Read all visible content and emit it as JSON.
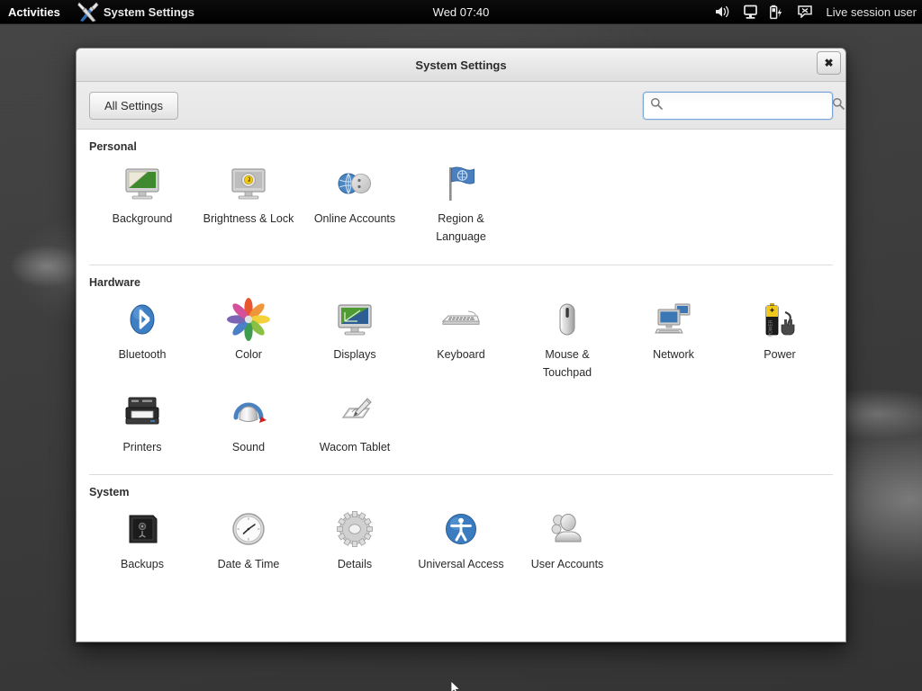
{
  "topbar": {
    "activities_label": "Activities",
    "app_icon": "tools-icon",
    "app_label": "System Settings",
    "clock": "Wed 07:40",
    "indicators": [
      {
        "name": "volume-icon",
        "label": "volume"
      },
      {
        "name": "display-icon",
        "label": "display"
      },
      {
        "name": "battery-charging-icon",
        "label": "battery"
      },
      {
        "name": "messages-icon",
        "label": "messages"
      }
    ],
    "user_label": "Live session user"
  },
  "window": {
    "title": "System Settings",
    "close_label": "✖"
  },
  "toolbar": {
    "all_settings_label": "All Settings",
    "search_placeholder": "",
    "search_value": "",
    "search_icon_left": "search-icon",
    "search_icon_right": "search-icon"
  },
  "sections": [
    {
      "title": "Personal",
      "tiles": [
        {
          "label": "Background",
          "icon": "background-monitor-icon"
        },
        {
          "label": "Brightness & Lock",
          "icon": "brightness-lock-icon"
        },
        {
          "label": "Online Accounts",
          "icon": "online-accounts-icon"
        },
        {
          "label": "Region & Language",
          "icon": "region-language-flag-icon"
        }
      ]
    },
    {
      "title": "Hardware",
      "tiles": [
        {
          "label": "Bluetooth",
          "icon": "bluetooth-icon"
        },
        {
          "label": "Color",
          "icon": "color-flower-icon"
        },
        {
          "label": "Displays",
          "icon": "displays-icon"
        },
        {
          "label": "Keyboard",
          "icon": "keyboard-icon"
        },
        {
          "label": "Mouse & Touchpad",
          "icon": "mouse-icon"
        },
        {
          "label": "Network",
          "icon": "network-icon"
        },
        {
          "label": "Power",
          "icon": "power-battery-icon"
        },
        {
          "label": "Printers",
          "icon": "printer-icon"
        },
        {
          "label": "Sound",
          "icon": "sound-icon"
        },
        {
          "label": "Wacom Tablet",
          "icon": "wacom-tablet-icon"
        }
      ]
    },
    {
      "title": "System",
      "tiles": [
        {
          "label": "Backups",
          "icon": "backups-safe-icon"
        },
        {
          "label": "Date & Time",
          "icon": "clock-icon"
        },
        {
          "label": "Details",
          "icon": "gear-icon"
        },
        {
          "label": "Universal Access",
          "icon": "universal-access-icon"
        },
        {
          "label": "User Accounts",
          "icon": "user-accounts-icon"
        }
      ]
    }
  ],
  "colors": {
    "topbar_bg": "#000000",
    "window_bg": "#ffffff",
    "titlebar_bg": "#e8e8e8",
    "search_focus_border": "#7aa7d8",
    "accent_blue": "#3465a4",
    "desktop_bg": "#3a3a3a"
  }
}
